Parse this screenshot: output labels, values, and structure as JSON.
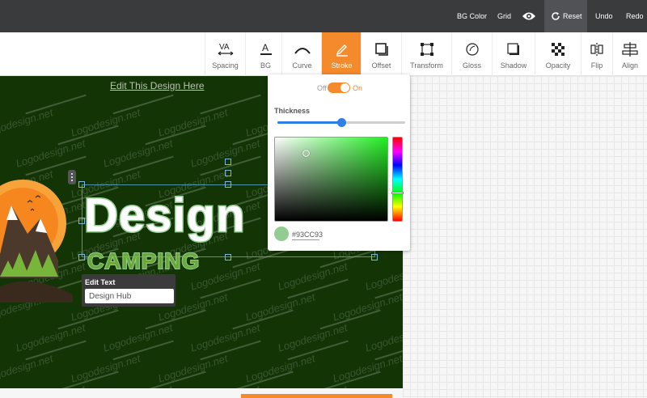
{
  "topbar": {
    "bg_color": "BG Color",
    "grid": "Grid",
    "reset": "Reset",
    "undo": "Undo",
    "redo": "Redo"
  },
  "toolbar": {
    "tools": [
      {
        "label": "Spacing",
        "icon": "letter-spacing-icon"
      },
      {
        "label": "BG",
        "icon": "text-background-icon"
      },
      {
        "label": "Curve",
        "icon": "curve-icon"
      },
      {
        "label": "Stroke",
        "icon": "pen-stroke-icon",
        "active": true
      },
      {
        "label": "Offset",
        "icon": "offset-icon"
      },
      {
        "label": "Transform",
        "icon": "transform-icon"
      },
      {
        "label": "Gloss",
        "icon": "gloss-icon"
      },
      {
        "label": "Shadow",
        "icon": "shadow-icon"
      },
      {
        "label": "Opacity",
        "icon": "checkerboard-icon"
      },
      {
        "label": "Flip",
        "icon": "flip-icon"
      },
      {
        "label": "Align",
        "icon": "align-icon"
      }
    ]
  },
  "canvas": {
    "edit_link": "Edit This Design Here",
    "watermark": "Logodesign.net",
    "headline": "Design",
    "subline": "CAMPING",
    "background_color": "#133506"
  },
  "edit_text": {
    "title": "Edit Text",
    "value": "Design Hub"
  },
  "stroke_panel": {
    "toggle_off": "Off",
    "toggle_on": "On",
    "enabled": true,
    "thickness_label": "Thickness",
    "thickness_value": 0.5,
    "hex_value": "#93CC93",
    "color": "#93cc93",
    "accent_color": "#f48a2b"
  }
}
